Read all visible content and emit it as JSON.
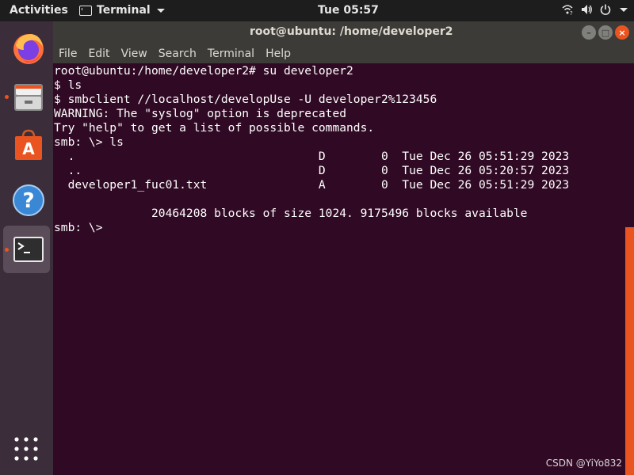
{
  "topbar": {
    "activities": "Activities",
    "app_name": "Terminal",
    "clock": "Tue 05:57"
  },
  "dock": {
    "items": [
      {
        "name": "firefox",
        "icon": "firefox-icon",
        "running": false
      },
      {
        "name": "files",
        "icon": "files-icon",
        "running": true
      },
      {
        "name": "software",
        "icon": "software-center-icon",
        "running": false
      },
      {
        "name": "help",
        "icon": "help-icon",
        "running": false
      },
      {
        "name": "terminal",
        "icon": "terminal-icon",
        "running": true,
        "active": true
      }
    ],
    "show_apps_icon": "grid-icon"
  },
  "window": {
    "title": "root@ubuntu: /home/developer2",
    "menu": [
      "File",
      "Edit",
      "View",
      "Search",
      "Terminal",
      "Help"
    ]
  },
  "terminal": {
    "lines": [
      "root@ubuntu:/home/developer2# su developer2",
      "$ ls",
      "$ smbclient //localhost/developUse -U developer2%123456",
      "WARNING: The \"syslog\" option is deprecated",
      "Try \"help\" to get a list of possible commands.",
      "smb: \\> ls",
      "  .                                   D        0  Tue Dec 26 05:51:29 2023",
      "  ..                                  D        0  Tue Dec 26 05:20:57 2023",
      "  developer1_fuc01.txt                A        0  Tue Dec 26 05:51:29 2023",
      "",
      "              20464208 blocks of size 1024. 9175496 blocks available",
      "smb: \\>"
    ]
  },
  "watermark": "CSDN @YiYo832",
  "colors": {
    "terminal_bg": "#300a24",
    "accent": "#e95420",
    "titlebar": "#3c3b37",
    "topbar": "#1d1d1d"
  }
}
